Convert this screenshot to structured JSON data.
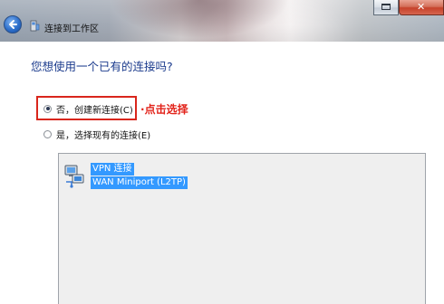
{
  "window": {
    "title": "连接到工作区",
    "close_label": "✕"
  },
  "prompt": {
    "question": "您想使用一个已有的连接吗?"
  },
  "options": [
    {
      "label": "否，创建新连接(C)",
      "selected": true
    },
    {
      "label": "是，选择现有的连接(E)",
      "selected": false
    }
  ],
  "annotation": {
    "text": "点击选择",
    "color": "#e2231a"
  },
  "connections": [
    {
      "name": "VPN 连接",
      "type": "WAN Miniport (L2TP)",
      "selected": true,
      "icon": "network-connection-icon"
    }
  ],
  "colors": {
    "heading": "#1a3a8c",
    "selection": "#3399ff",
    "highlight_border": "#d9261c"
  }
}
